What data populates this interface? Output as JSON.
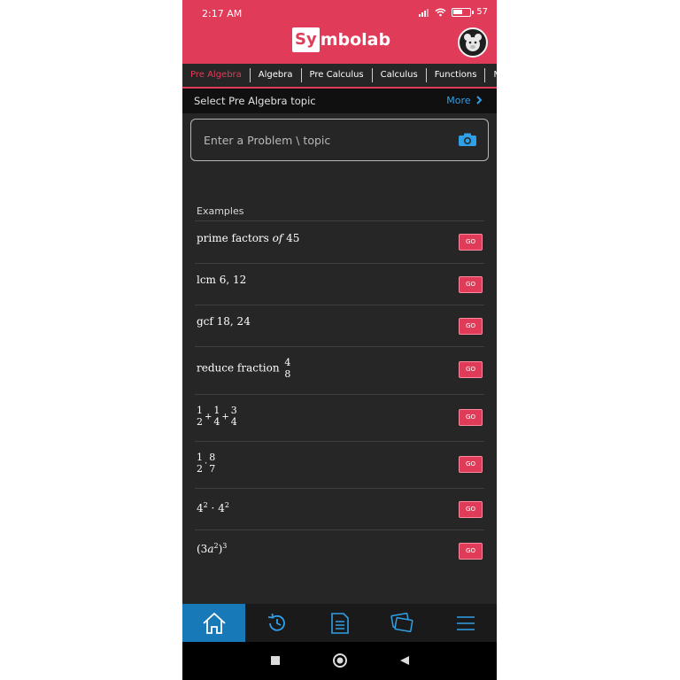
{
  "status": {
    "time": "2:17 AM",
    "battery": "57",
    "battery_level": 0.57
  },
  "header": {
    "logo_box": "Sy",
    "logo_rest": "mbolab"
  },
  "tabs": [
    "Pre Algebra",
    "Algebra",
    "Pre Calculus",
    "Calculus",
    "Functions",
    "Mat"
  ],
  "topic": {
    "label": "Select Pre Algebra topic",
    "more": "More"
  },
  "search": {
    "placeholder": "Enter a Problem \\ topic"
  },
  "examples": {
    "title": "Examples",
    "go_label": "GO",
    "items": [
      {
        "prefix": "prime factors ",
        "ital": "of",
        "suffix": " 45"
      },
      {
        "text": "lcm 6,  12"
      },
      {
        "text": "gcf 18,  24"
      },
      {
        "prefix": "reduce fraction ",
        "num": "4",
        "den": "8"
      },
      {
        "f1n": "1",
        "f1d": "2",
        "op1": "+",
        "f2n": "1",
        "f2d": "4",
        "op2": "+",
        "f3n": "3",
        "f3d": "4"
      },
      {
        "f1n": "1",
        "f1d": "2",
        "op1": "·",
        "f2n": "8",
        "f2d": "7"
      },
      {
        "base1": "4",
        "exp1": "2",
        "op": " · ",
        "base2": "4",
        "exp2": "2"
      },
      {
        "open": "(3",
        "var": "a",
        "exp_in": "2",
        "close": ")",
        "exp_out": "3"
      }
    ]
  },
  "colors": {
    "brand": "#e03c5a",
    "link": "#2f9fe8",
    "nav_active": "#1779b7",
    "bg": "#262626"
  },
  "nav_icons": [
    "home-icon",
    "history-icon",
    "notebook-icon",
    "practice-icon",
    "menu-icon"
  ]
}
